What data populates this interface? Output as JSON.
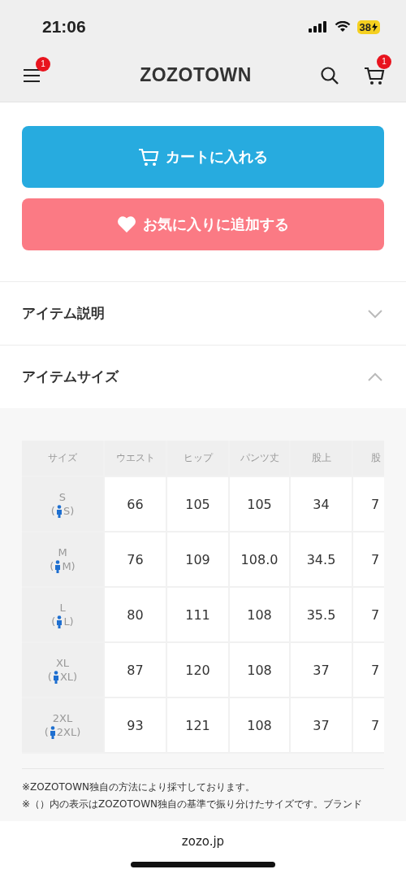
{
  "status_bar": {
    "time": "21:06",
    "battery": "38"
  },
  "header": {
    "logo": "ZOZOTOWN",
    "menu_badge": "1",
    "cart_badge": "1"
  },
  "buttons": [
    {
      "kind": "cart",
      "label": "カートに入れる"
    },
    {
      "kind": "favorite",
      "label": "お気に入りに追加する"
    }
  ],
  "sections": [
    {
      "title": "アイテム説明",
      "expanded": false
    },
    {
      "title": "アイテムサイズ",
      "expanded": true
    }
  ],
  "size_table": {
    "columns": [
      "サイズ",
      "ウエスト",
      "ヒップ",
      "パンツ丈",
      "股上",
      "股"
    ],
    "rows": [
      {
        "size": "S",
        "zozo_bracket": "(",
        "zozo_size": "S)",
        "values": [
          "66",
          "105",
          "105",
          "34",
          "7"
        ]
      },
      {
        "size": "M",
        "zozo_bracket": "(",
        "zozo_size": "M)",
        "values": [
          "76",
          "109",
          "108.0",
          "34.5",
          "7"
        ]
      },
      {
        "size": "L",
        "zozo_bracket": "(",
        "zozo_size": "L)",
        "values": [
          "80",
          "111",
          "108",
          "35.5",
          "7"
        ]
      },
      {
        "size": "XL",
        "zozo_bracket": "(",
        "zozo_size": "XL)",
        "values": [
          "87",
          "120",
          "108",
          "37",
          "7"
        ]
      },
      {
        "size": "2XL",
        "zozo_bracket": "(",
        "zozo_size": "2XL)",
        "values": [
          "93",
          "121",
          "108",
          "37",
          "7"
        ]
      }
    ]
  },
  "notes": [
    "※ZOZOTOWN独自の方法により採寸しております。",
    "※（）内の表示はZOZOTOWN独自の基準で振り分けたサイズです。ブランド"
  ],
  "browser_bar": {
    "url": "zozo.jp"
  }
}
